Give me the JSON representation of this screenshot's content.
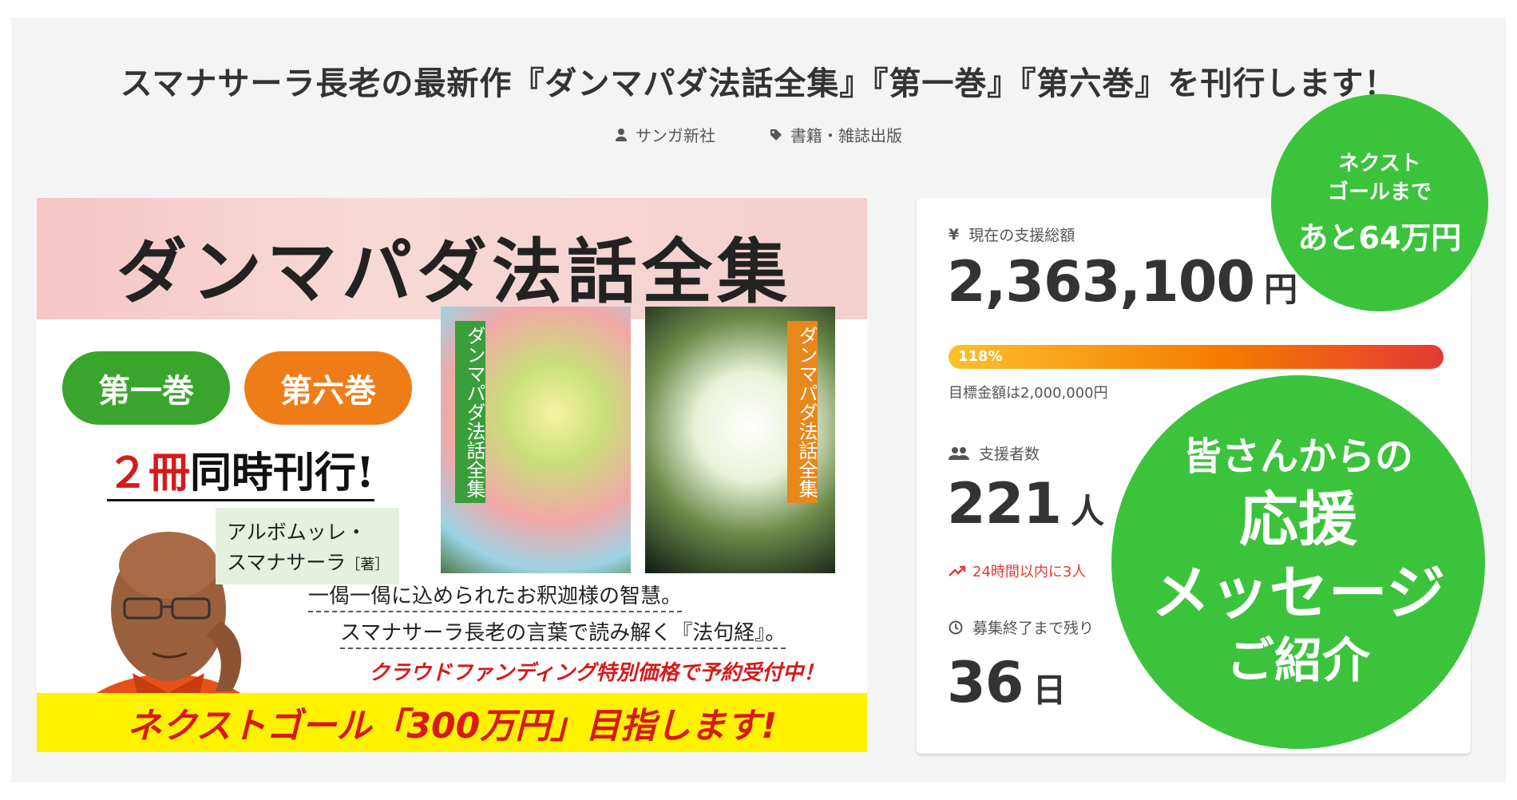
{
  "project": {
    "title": "スマナサーラ長老の最新作『ダンマパダ法話全集』『第一巻』『第六巻』を刊行します！",
    "owner": "サンガ新社",
    "category": "書籍・雑誌出版"
  },
  "banner": {
    "heading": "ダンマパダ法話全集",
    "volume1": "第一巻",
    "volume6": "第六巻",
    "simul_prefix": "２冊",
    "simul_suffix": "同時刊行!",
    "cover_title": "ダンマパダ法話全集",
    "author_line1": "アルボムッレ・",
    "author_line2": "スマナサーラ",
    "author_note": "［著］",
    "line1": "一偈一偈に込められたお釈迦様の智慧。",
    "line2": "スマナサーラ長老の言葉で読み解く『法句経』。",
    "line3": "クラウドファンディング特別価格で予約受付中！",
    "bottom": "ネクストゴール「300万円」目指します!"
  },
  "stats": {
    "amount_label": "現在の支援総額",
    "amount": "2,363,100",
    "amount_unit": "円",
    "progress_label": "118%",
    "progress": 1.18,
    "goal_text": "目標金額は2,000,000円",
    "supporters_label": "支援者数",
    "supporters": "221",
    "supporters_unit": "人",
    "trend_text": "24時間以内に3人",
    "remaining_label": "募集終了まで残り",
    "remaining": "36",
    "remaining_unit": "日"
  },
  "badges": {
    "next_goal_line1": "ネクスト",
    "next_goal_line2": "ゴールまで",
    "next_goal_line3": "あと64万円",
    "message_line1": "皆さんからの",
    "message_line2": "応援",
    "message_line3": "メッセージ",
    "message_line4": "ご紹介"
  },
  "colors": {
    "badge_green": "#3cc33c",
    "accent_red": "#e53935",
    "banner_yellow": "#fff200"
  }
}
